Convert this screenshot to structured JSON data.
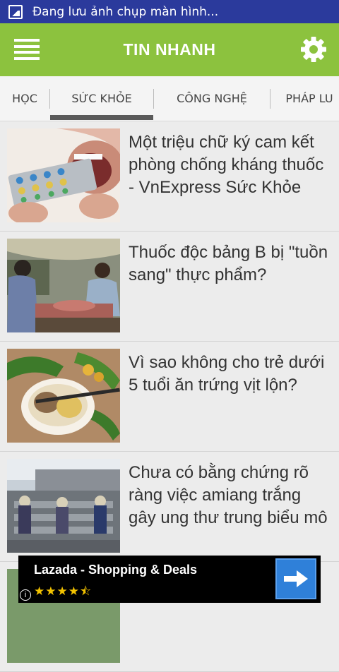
{
  "status_bar": {
    "text": "Đang lưu ảnh chụp màn hình...",
    "icon": "screenshot-icon"
  },
  "app_bar": {
    "title": "TIN NHANH",
    "menu_icon": "menu-icon",
    "settings_icon": "gear-icon",
    "color": "#8cc23e"
  },
  "tabs": [
    {
      "label": "HỌC",
      "active": false
    },
    {
      "label": "SỨC KHỎE",
      "active": true
    },
    {
      "label": "CÔNG NGHỆ",
      "active": false
    },
    {
      "label": "PHÁP LU",
      "active": false
    }
  ],
  "articles": [
    {
      "title": "Một triệu chữ ký cam kết phòng chống kháng thuốc - VnExpress Sức Khỏe",
      "image": "pills-in-mouth-photo"
    },
    {
      "title": "Thuốc độc bảng B bị \"tuồn sang\" thực phẩm?",
      "image": "market-vendors-photo"
    },
    {
      "title": "Vì sao không cho trẻ dưới 5 tuổi ăn trứng vịt lộn?",
      "image": "balut-eggs-photo"
    },
    {
      "title": "Chưa có bằng chứng rõ ràng việc amiang trắng gây ung thư trung biểu mô",
      "image": "asbestos-roof-workers-photo"
    }
  ],
  "ad": {
    "name": "Lazada - Shopping & Deals",
    "rating_stars": "★★★★⯪",
    "info": "i",
    "button_icon": "arrow-right-icon"
  }
}
